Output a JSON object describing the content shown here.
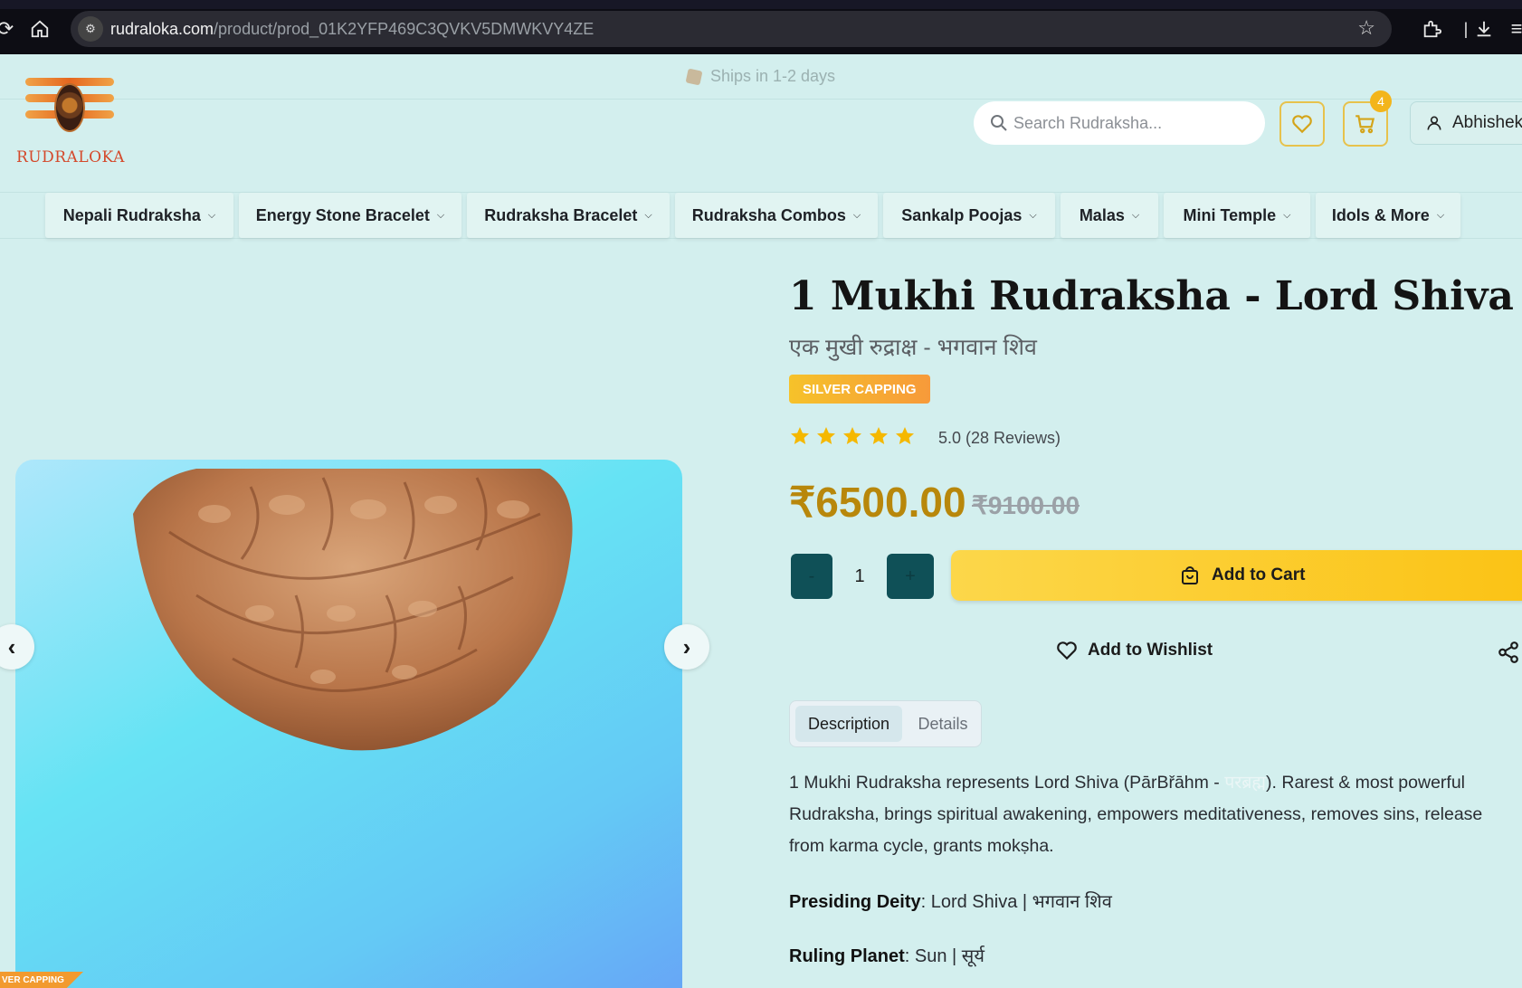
{
  "browser": {
    "url_host": "rudraloka.com",
    "url_path": "/product/prod_01K2YFP469C3QVKV5DMWKVY4ZE"
  },
  "banner": {
    "text": "Ships in 1-2 days"
  },
  "header": {
    "logo_text": "RUDRALOKA",
    "search_placeholder": "Search Rudraksha...",
    "cart_count": "4",
    "user_name": "Abhishek"
  },
  "nav": {
    "items": [
      {
        "label": "Nepali Rudraksha"
      },
      {
        "label": "Energy Stone Bracelet"
      },
      {
        "label": "Rudraksha Bracelet"
      },
      {
        "label": "Rudraksha Combos"
      },
      {
        "label": "Sankalp Poojas"
      },
      {
        "label": "Malas"
      },
      {
        "label": "Mini Temple"
      },
      {
        "label": "Idols & More"
      }
    ]
  },
  "gallery": {
    "corner_tag": "VER CAPPING"
  },
  "product": {
    "title": "1 Mukhi Rudraksha - Lord Shiva",
    "subtitle": "एक मुखी रुद्राक्ष - भगवान शिव",
    "badge": "SILVER CAPPING",
    "rating_stars": 5,
    "rating_text": "5.0 (28 Reviews)",
    "price": "₹6500.00",
    "old_price": "₹9100.00",
    "quantity": "1",
    "qty_minus": "-",
    "qty_plus": "+",
    "add_to_cart": "Add to Cart",
    "add_to_wishlist": "Add to Wishlist",
    "tabs": [
      "Description",
      "Details"
    ],
    "description_part1": "1 Mukhi Rudraksha represents Lord Shiva (PārBřāhm - ",
    "description_faint": "परब्रह्म",
    "description_part2": "). Rarest & most powerful Rudraksha, brings spiritual awakening, empowers meditativeness, removes sins, release from karma cycle, grants mokṣha.",
    "presiding_deity_label": "Presiding Deity",
    "presiding_deity_value": ": Lord Shiva | भगवान शिव",
    "ruling_planet_label": "Ruling Planet",
    "ruling_planet_value": ": Sun | सूर्य"
  },
  "colors": {
    "page_bg": "#d3efee",
    "price": "#b8870b",
    "add_to_cart": "#fbc315",
    "qty_button": "#0f5057",
    "star": "#f5b800"
  }
}
